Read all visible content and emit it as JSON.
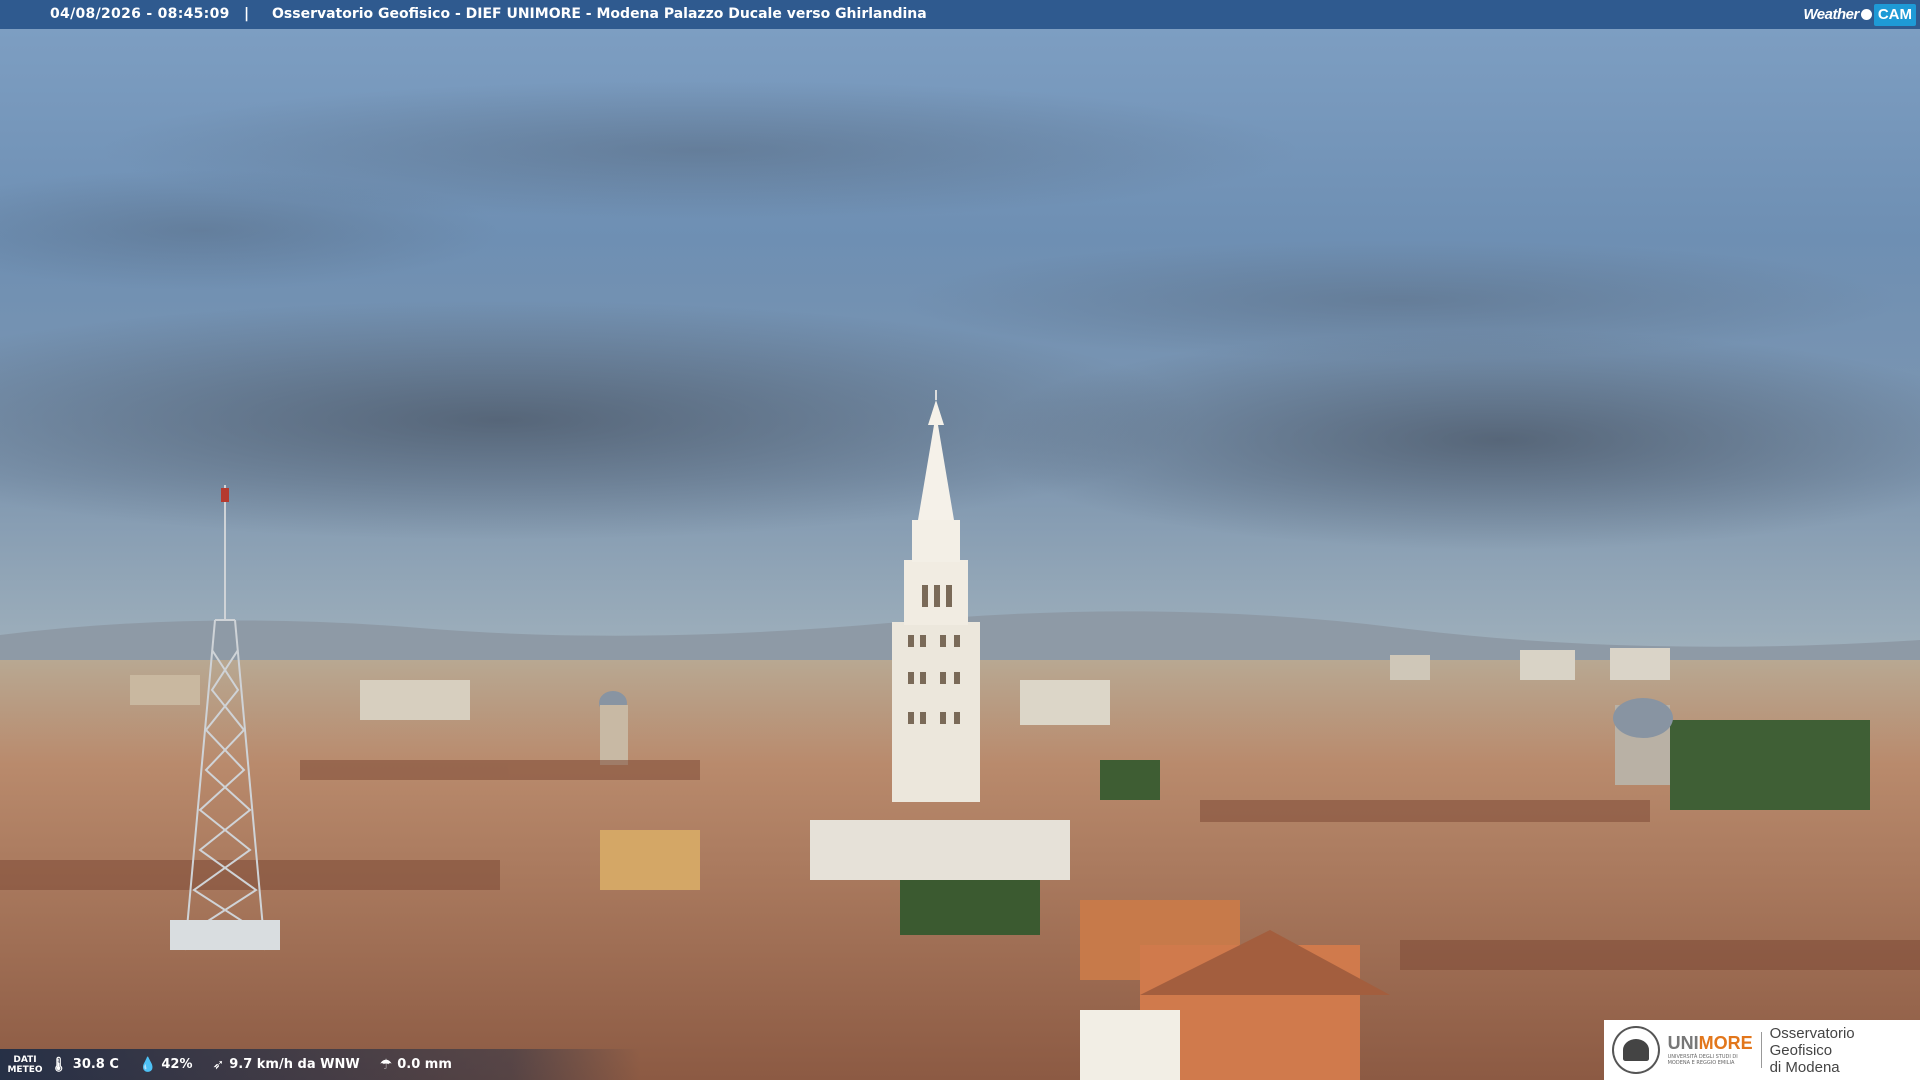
{
  "header": {
    "timestamp": "04/08/2026 - 08:45:09",
    "separator": "|",
    "title": "Osservatorio Geofisico - DIEF UNIMORE - Modena Palazzo Ducale verso Ghirlandina",
    "logo_weather": "Weather",
    "logo_cam": "CAM"
  },
  "weather": {
    "label": "DATI METEO",
    "temperature": "30.8 C",
    "humidity": "42%",
    "wind": "9.7 km/h da WNW",
    "rain": "0.0 mm",
    "icons": [
      "thermometer-icon",
      "droplet-icon",
      "wind-icon",
      "rain-icon"
    ]
  },
  "logo": {
    "brand_left": "UNI",
    "brand_right": "MORE",
    "sub": "UNIVERSITÀ DEGLI STUDI DI MODENA E REGGIO EMILIA",
    "observatory_line1": "Osservatorio Geofisico",
    "observatory_line2": "di Modena"
  },
  "colors": {
    "bar": "#2f5a8f",
    "accent": "#e2761b",
    "cam_badge": "#1e9ad6"
  }
}
